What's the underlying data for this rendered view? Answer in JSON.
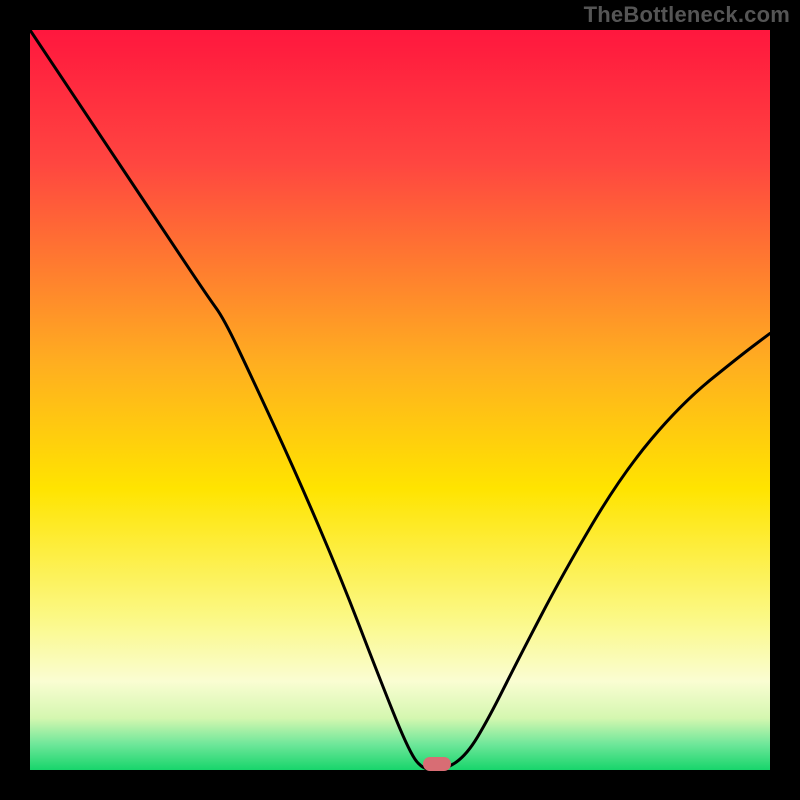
{
  "watermark": "TheBottleneck.com",
  "marker": {
    "x_frac": 0.55,
    "y_frac": 0.992
  },
  "chart_data": {
    "type": "line",
    "title": "",
    "xlabel": "",
    "ylabel": "",
    "xlim": [
      0,
      1
    ],
    "ylim": [
      0,
      1
    ],
    "gradient_stops": [
      {
        "offset": 0.0,
        "color": "#ff173e"
      },
      {
        "offset": 0.18,
        "color": "#ff4640"
      },
      {
        "offset": 0.45,
        "color": "#ffae20"
      },
      {
        "offset": 0.62,
        "color": "#ffe400"
      },
      {
        "offset": 0.8,
        "color": "#fbf98a"
      },
      {
        "offset": 0.88,
        "color": "#fafdd2"
      },
      {
        "offset": 0.93,
        "color": "#d4f7b0"
      },
      {
        "offset": 0.965,
        "color": "#6fe79a"
      },
      {
        "offset": 1.0,
        "color": "#17d56b"
      }
    ],
    "series": [
      {
        "name": "bottleneck-curve",
        "x": [
          0.0,
          0.06,
          0.12,
          0.18,
          0.24,
          0.262,
          0.3,
          0.36,
          0.42,
          0.47,
          0.51,
          0.53,
          0.56,
          0.59,
          0.62,
          0.66,
          0.72,
          0.8,
          0.88,
          0.96,
          1.0
        ],
        "y": [
          1.0,
          0.91,
          0.82,
          0.73,
          0.64,
          0.61,
          0.53,
          0.4,
          0.26,
          0.13,
          0.03,
          0.0,
          0.0,
          0.02,
          0.07,
          0.15,
          0.265,
          0.4,
          0.495,
          0.56,
          0.59
        ]
      }
    ],
    "marker": {
      "x": 0.55,
      "y": 0.0,
      "color": "#d86d74"
    }
  }
}
